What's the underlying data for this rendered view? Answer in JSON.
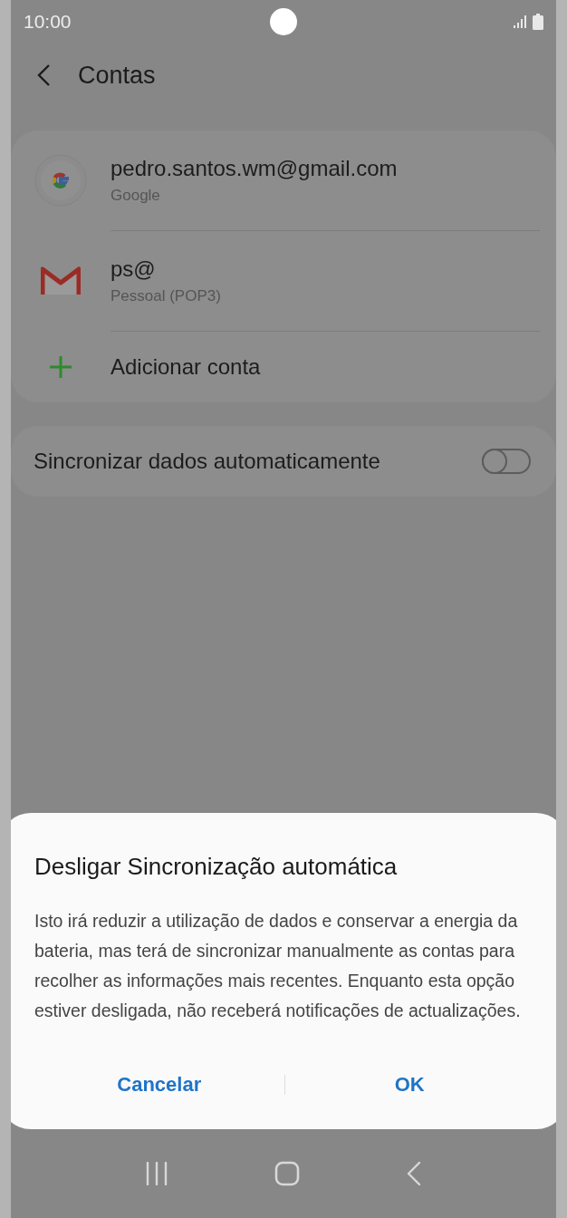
{
  "status_bar": {
    "time": "10:00"
  },
  "header": {
    "title": "Contas"
  },
  "accounts": [
    {
      "kind": "google",
      "name": "pedro.santos.wm@gmail.com",
      "type": "Google"
    },
    {
      "kind": "gmail",
      "name": "ps@",
      "type": "Pessoal (POP3)"
    }
  ],
  "add_account": {
    "label": "Adicionar conta"
  },
  "sync": {
    "label": "Sincronizar dados automaticamente",
    "on": false
  },
  "dialog": {
    "title": "Desligar Sincronização automática",
    "message": "Isto irá reduzir a utilização de dados e conservar a energia da bateria, mas terá de sincronizar manualmente as contas para recolher as informações mais recentes. Enquanto esta opção estiver desligada, não receberá notificações de actualizações.",
    "buttons": [
      "Cancelar",
      "OK"
    ]
  }
}
